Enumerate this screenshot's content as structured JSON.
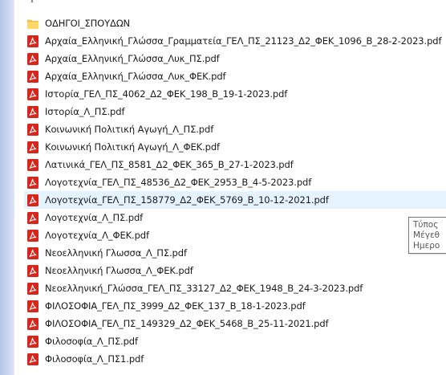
{
  "folder": {
    "name": "ΟΔΗΓΟΙ_ΣΠΟΥΔΩΝ",
    "icon": "folder-icon"
  },
  "files": [
    {
      "name": "Αρχαία_Ελληνική_Γλώσσα_Γραμματεία_ΓΕΛ_ΠΣ_21123_Δ2_ΦΕΚ_1096_Β_28-2-2023.pdf",
      "icon": "pdf-icon"
    },
    {
      "name": "Αρχαία_Ελληνική_Γλώσσα_Λυκ_ΠΣ.pdf",
      "icon": "pdf-icon"
    },
    {
      "name": "Αρχαία_Ελληνική_Γλώσσα_Λυκ_ΦΕΚ.pdf",
      "icon": "pdf-icon"
    },
    {
      "name": "Ιστορία_ΓΕΛ_ΠΣ_4062_Δ2_ΦΕΚ_198_Β_19-1-2023.pdf",
      "icon": "pdf-icon"
    },
    {
      "name": "Ιστορία_Λ_ΠΣ.pdf",
      "icon": "pdf-icon"
    },
    {
      "name": "Κοινωνική Πολιτική Αγωγή_Λ_ΠΣ.pdf",
      "icon": "pdf-icon"
    },
    {
      "name": "Κοινωνική Πολιτική Αγωγή_Λ_ΦΕΚ.pdf",
      "icon": "pdf-icon"
    },
    {
      "name": "Λατινικά_ΓΕΛ_ΠΣ_8581_Δ2_ΦΕΚ_365_Β_27-1-2023.pdf",
      "icon": "pdf-icon"
    },
    {
      "name": "Λογοτεχνία_ΓΕΛ_ΠΣ_48536_Δ2_ΦΕΚ_2953_Β_4-5-2023.pdf",
      "icon": "pdf-icon"
    },
    {
      "name": "Λογοτεχνία_ΓΕΛ_ΠΣ_158779_Δ2_ΦΕΚ_5769_Β_10-12-2021.pdf",
      "icon": "pdf-icon",
      "selected": true
    },
    {
      "name": "Λογοτεχνία_Λ_ΠΣ.pdf",
      "icon": "pdf-icon"
    },
    {
      "name": "Λογοτεχνία_Λ_ΦΕΚ.pdf",
      "icon": "pdf-icon"
    },
    {
      "name": "Νεοελληνική Γλωσσα_Λ_ΠΣ.pdf",
      "icon": "pdf-icon"
    },
    {
      "name": "Νεοελληνική Γλωσσα_Λ_ΦΕΚ.pdf",
      "icon": "pdf-icon"
    },
    {
      "name": "Νεοελληνική_Γλώσσα_ΓΕΛ_ΠΣ_33127_Δ2_ΦΕΚ_1948_Β_24-3-2023.pdf",
      "icon": "pdf-icon"
    },
    {
      "name": "ΦΙΛΟΣΟΦΙΑ_ΓΕΛ_ΠΣ_3999_Δ2_ΦΕΚ_137_Β_18-1-2023.pdf",
      "icon": "pdf-icon"
    },
    {
      "name": "ΦΙΛΟΣΟΦΙΑ_ΓΕΛ_ΠΣ_149329_Δ2_ΦΕΚ_5468_Β_25-11-2021.pdf",
      "icon": "pdf-icon"
    },
    {
      "name": "Φιλοσοφία_Λ_ΠΣ.pdf",
      "icon": "pdf-icon"
    },
    {
      "name": "Φιλοσοφία_Λ_ΠΣ1.pdf",
      "icon": "pdf-icon"
    }
  ],
  "tooltip": {
    "line1": "Τύπος",
    "line2": "Μέγεθ",
    "line3": "Ημερο"
  },
  "colors": {
    "selection": "#e5f3ff",
    "pdf_red": "#d9261c",
    "folder_yellow": "#f5c443"
  }
}
